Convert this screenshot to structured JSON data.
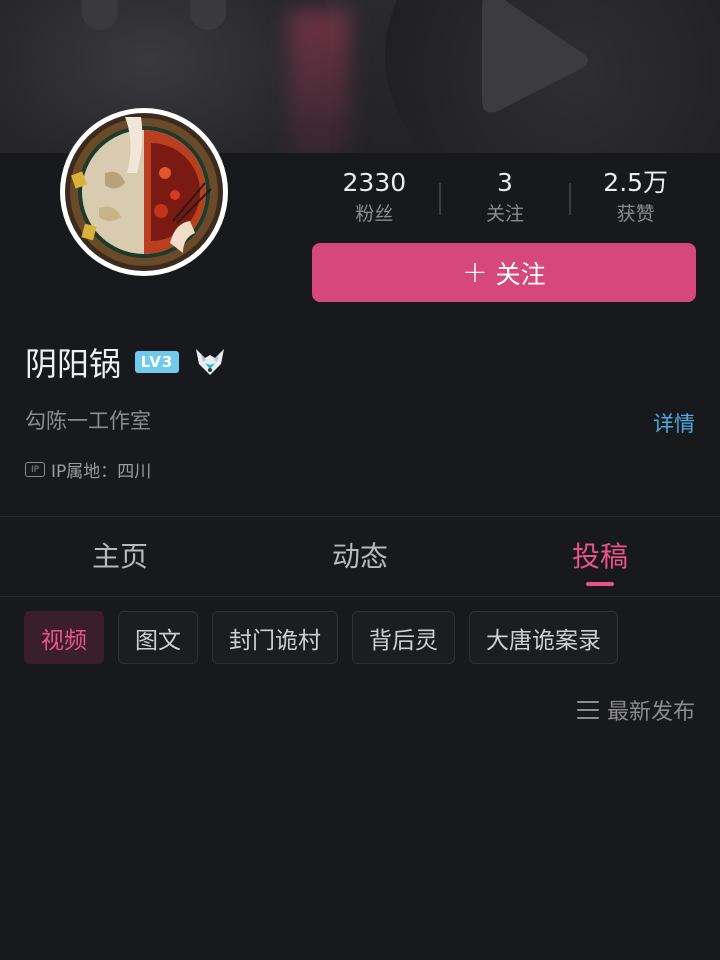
{
  "profile": {
    "name": "阴阳锅",
    "level_badge": "LV3",
    "studio": "勾陈一工作室",
    "detail_link": "详情",
    "ip_icon_text": "IP",
    "ip_location": "IP属地：四川"
  },
  "stats": [
    {
      "value": "2330",
      "label": "粉丝"
    },
    {
      "value": "3",
      "label": "关注"
    },
    {
      "value": "2.5万",
      "label": "获赞"
    }
  ],
  "follow_button": {
    "icon": "+",
    "label": "关注"
  },
  "tabs": [
    {
      "label": "主页",
      "active": false
    },
    {
      "label": "动态",
      "active": false
    },
    {
      "label": "投稿",
      "active": true
    }
  ],
  "filters": [
    {
      "label": "视频",
      "active": true
    },
    {
      "label": "图文",
      "active": false
    },
    {
      "label": "封门诡村",
      "active": false
    },
    {
      "label": "背后灵",
      "active": false
    },
    {
      "label": "大唐诡案录",
      "active": false
    }
  ],
  "sort": {
    "label": "最新发布",
    "icon": "list-icon"
  },
  "colors": {
    "accent": "#d6477a",
    "accent_text": "#e7538a",
    "link": "#4fa8df",
    "background": "#18191c",
    "level_badge": "#71c9ec"
  }
}
